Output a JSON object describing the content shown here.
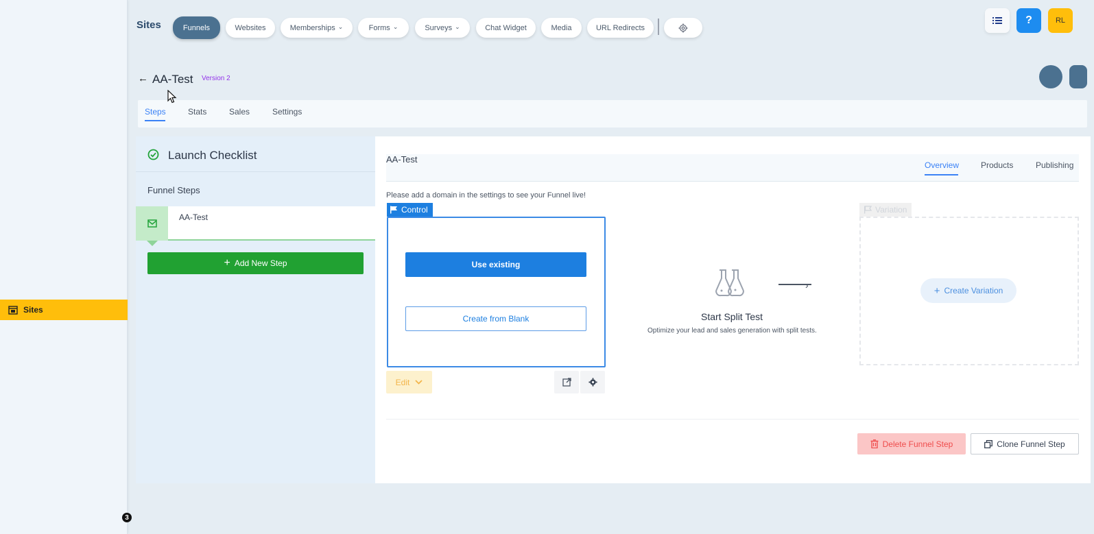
{
  "sidebar": {
    "active_item": "Sites"
  },
  "corner_badge": "3",
  "topbar": {
    "title": "Sites",
    "nav": {
      "funnels": "Funnels",
      "websites": "Websites",
      "memberships": "Memberships",
      "forms": "Forms",
      "surveys": "Surveys",
      "chat_widget": "Chat Widget",
      "media": "Media",
      "url_redirects": "URL Redirects"
    },
    "avatar_initials": "RL",
    "help_label": "?"
  },
  "page": {
    "back_label": "←",
    "title": "AA-Test",
    "version": "Version 2"
  },
  "tabs": {
    "steps": "Steps",
    "stats": "Stats",
    "sales": "Sales",
    "settings": "Settings"
  },
  "left_panel": {
    "checklist_title": "Launch Checklist",
    "funnel_steps_label": "Funnel Steps",
    "steps": [
      {
        "label": "AA-Test"
      }
    ],
    "add_step_label": "Add New Step"
  },
  "main": {
    "title": "AA-Test",
    "tabs": {
      "overview": "Overview",
      "products": "Products",
      "publishing": "Publishing"
    },
    "domain_notice": "Please add a domain in the settings to see your Funnel live!",
    "control": {
      "flag_label": "Control",
      "use_existing_label": "Use existing",
      "create_blank_label": "Create from Blank",
      "edit_label": "Edit"
    },
    "split_test": {
      "title": "Start Split Test",
      "description": "Optimize your lead and sales generation with split tests."
    },
    "variation": {
      "flag_label": "Variation",
      "create_label": "Create Variation"
    },
    "delete_label": "Delete Funnel Step",
    "clone_label": "Clone Funnel Step"
  },
  "colors": {
    "accent": "#1d7fe0",
    "active_nav": "#4b7190",
    "sidebar_active": "#ffbe0b",
    "success": "#21a132",
    "danger": "#ef4c4c"
  },
  "icons": [
    "sites-icon",
    "list-icon",
    "help-icon",
    "gear-icon",
    "check-circle-icon",
    "mail-icon",
    "plus-icon",
    "flag-icon",
    "chevron-down-icon",
    "external-link-icon",
    "flask-icon",
    "arrow-right-icon",
    "trash-icon",
    "copy-icon"
  ]
}
